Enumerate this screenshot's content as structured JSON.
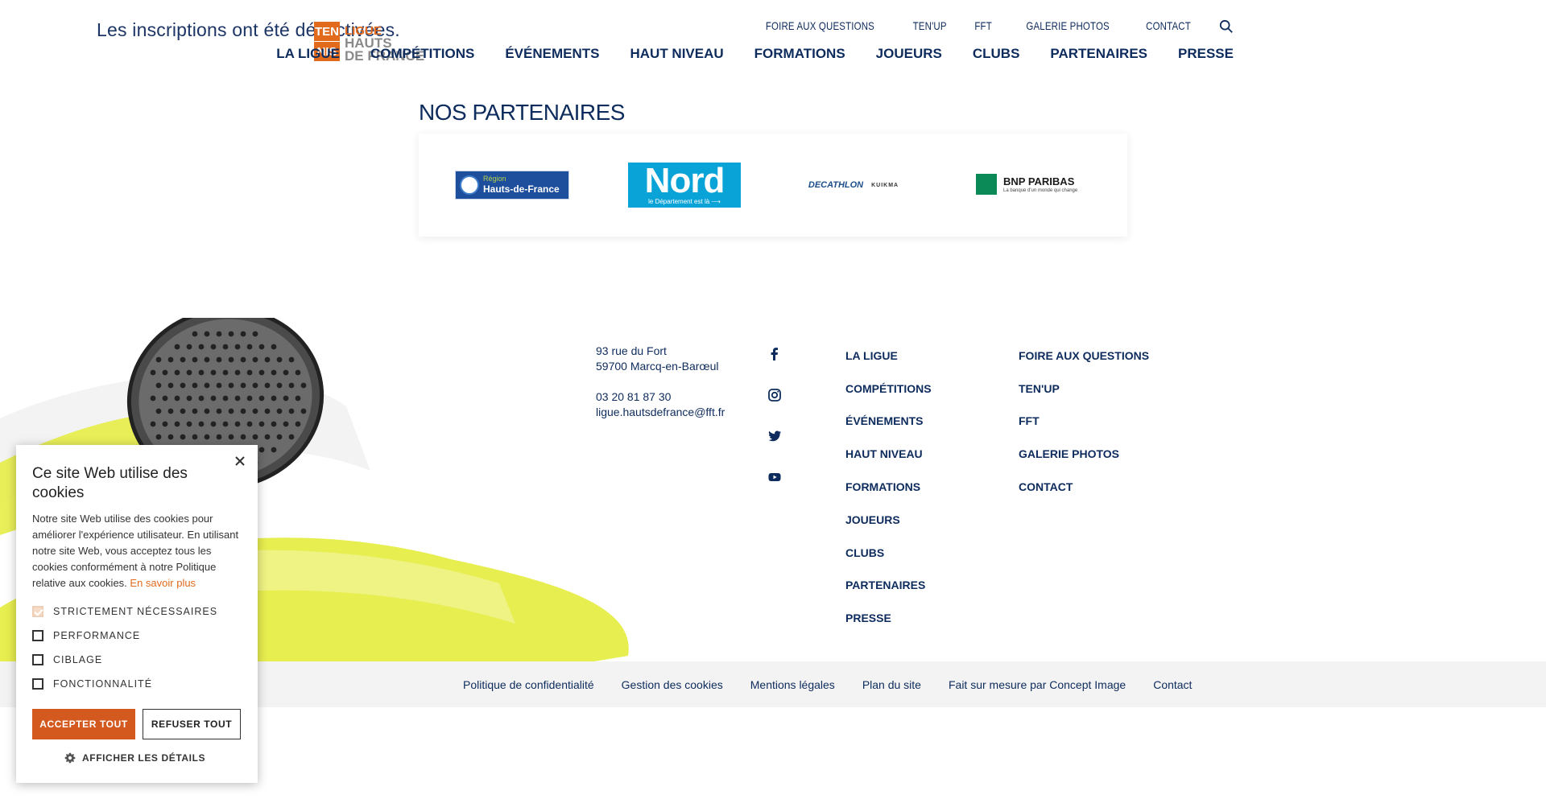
{
  "header": {
    "notice": "Les inscriptions ont été désactivées.",
    "logo": {
      "tile1": "TEN",
      "tile2": "NIS",
      "line1": "LIGUE",
      "line2": "HAUTS",
      "line3": "DE FRANCE"
    },
    "top_links": [
      "FOIRE AUX QUESTIONS",
      "TEN'UP",
      "FFT",
      "GALERIE PHOTOS",
      "CONTACT"
    ],
    "main_nav": [
      "LA LIGUE",
      "COMPÉTITIONS",
      "ÉVÉNEMENTS",
      "HAUT NIVEAU",
      "FORMATIONS",
      "JOUEURS",
      "CLUBS",
      "PARTENAIRES",
      "PRESSE"
    ]
  },
  "partners": {
    "title": "NOS PARTENAIRES",
    "region": {
      "line1": "Région",
      "line2": "Hauts-de-France"
    },
    "nord": {
      "line1": "Nord",
      "line2": "le Département est là ⟶"
    },
    "decathlon": {
      "name": "DECATHLON",
      "sub": "KUIKMA"
    },
    "bnp": {
      "name": "BNP PARIBAS",
      "tagline": "La banque d'un monde qui change"
    }
  },
  "footer": {
    "address": [
      "93 rue du Fort",
      "59700 Marcq-en-Barœul"
    ],
    "phone": "03 20 81 87 30",
    "email": "ligue.hautsdefrance@fft.fr",
    "social": [
      "facebook-icon",
      "instagram-icon",
      "twitter-icon",
      "youtube-icon"
    ],
    "nav_col1": [
      "LA LIGUE",
      "COMPÉTITIONS",
      "ÉVÉNEMENTS",
      "HAUT NIVEAU",
      "FORMATIONS",
      "JOUEURS",
      "CLUBS",
      "PARTENAIRES",
      "PRESSE"
    ],
    "nav_col2": [
      "FOIRE AUX QUESTIONS",
      "TEN'UP",
      "FFT",
      "GALERIE PHOTOS",
      "CONTACT"
    ]
  },
  "bottom_links": [
    "Politique de confidentialité",
    "Gestion des cookies",
    "Mentions légales",
    "Plan du site",
    "Fait sur mesure par Concept Image",
    "Contact"
  ],
  "cookie": {
    "title": "Ce site Web utilise des cookies",
    "description": "Notre site Web utilise des cookies pour améliorer l'expérience utilisateur. En utilisant notre site Web, vous acceptez tous les cookies conformément à notre Politique relative aux cookies.",
    "more_link": "En savoir plus",
    "options": [
      {
        "label": "STRICTEMENT NÉCESSAIRES",
        "checked": true
      },
      {
        "label": "PERFORMANCE",
        "checked": false
      },
      {
        "label": "CIBLAGE",
        "checked": false
      },
      {
        "label": "FONCTIONNALITÉ",
        "checked": false
      }
    ],
    "accept": "ACCEPTER TOUT",
    "refuse": "REFUSER TOUT",
    "details": "AFFICHER LES DÉTAILS"
  },
  "colors": {
    "navy": "#0d2b5c",
    "orange": "#e16a1d",
    "accept_button": "#d3591f",
    "yellow": "#e4ec3c"
  }
}
